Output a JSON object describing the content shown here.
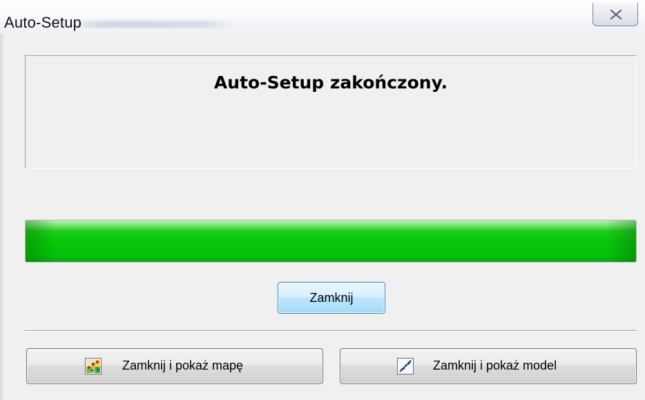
{
  "window": {
    "title": "Auto-Setup"
  },
  "message": {
    "text": "Auto-Setup zakończony."
  },
  "progress": {
    "value_percent": 100,
    "color": "#08c70d"
  },
  "buttons": {
    "close_label": "Zamknij",
    "close_show_map_label": "Zamknij i pokaż mapę",
    "close_show_model_label": "Zamknij i pokaż model"
  },
  "icons": {
    "window_close": "close-icon",
    "map": "map-icon",
    "model": "model-icon"
  },
  "colors": {
    "accent_blue": "#3c7fb1",
    "progress_green": "#08c70d",
    "window_bg": "#f0f0f0"
  }
}
